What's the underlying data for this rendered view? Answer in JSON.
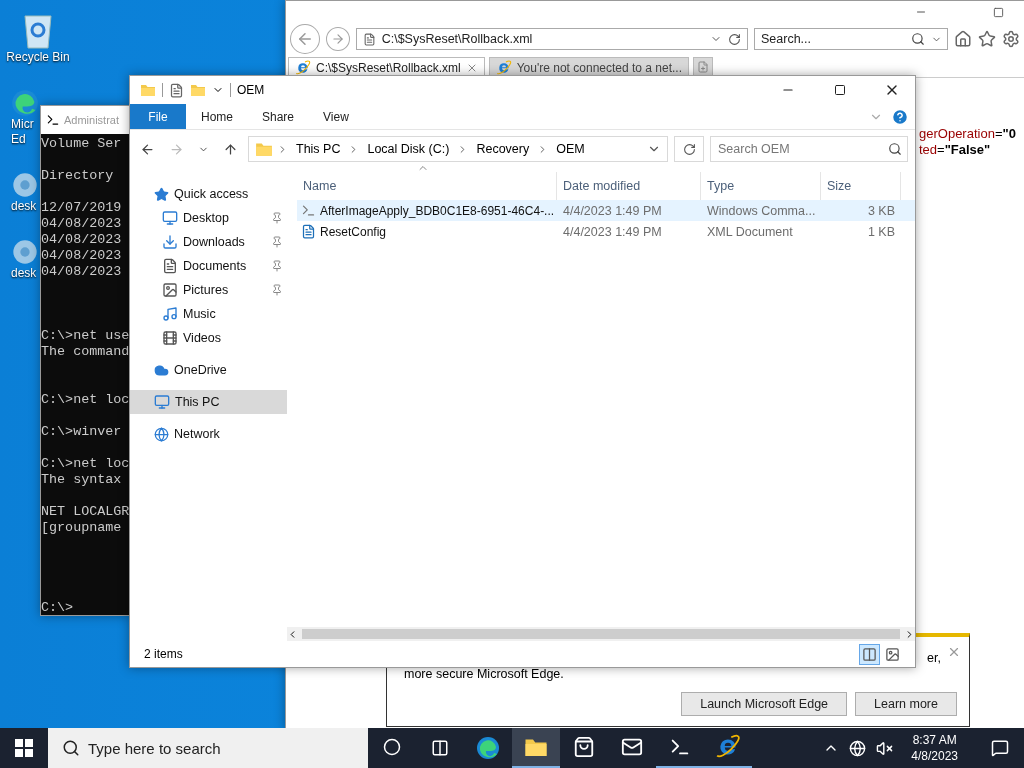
{
  "desktop": {
    "icons": [
      {
        "lines": [
          "Recycle Bin"
        ]
      },
      {
        "lines": [
          "Micr",
          "Ed"
        ]
      },
      {
        "lines": [
          "desk"
        ]
      },
      {
        "lines": [
          "desk"
        ]
      }
    ]
  },
  "browser": {
    "address": "C:\\$SysReset\\Rollback.xml",
    "search": {
      "placeholder": "Search..."
    },
    "tabs": [
      {
        "label": "C:\\$SysReset\\Rollback.xml",
        "selected": true
      },
      {
        "label": "You're not connected to a net...",
        "selected": false
      }
    ],
    "xml_lines": [
      {
        "attr": "gerOperation",
        "sep": "=",
        "value": "\"0"
      },
      {
        "attr": "ted",
        "sep": "=",
        "value": "\"False\""
      }
    ],
    "notification": {
      "lines": [
        "er,",
        "more secure Microsoft Edge."
      ],
      "buttons": [
        "Launch Microsoft Edge",
        "Learn more"
      ]
    }
  },
  "console": {
    "title": "Administrat",
    "blocks": [
      [
        "Volume Ser"
      ],
      [
        "Directory"
      ],
      [
        "12/07/2019",
        "04/08/2023",
        "04/08/2023",
        "04/08/2023",
        "04/08/2023"
      ],
      [
        "C:\\>net use",
        "The command"
      ],
      [
        "C:\\>net loc"
      ],
      [
        "C:\\>winver"
      ],
      [
        "C:\\>net loc",
        "The syntax"
      ],
      [
        "NET LOCALGR",
        "[groupname"
      ],
      [
        "C:\\>"
      ]
    ]
  },
  "explorer": {
    "title": "OEM",
    "file_tab": "File",
    "ribbon_tabs": [
      "Home",
      "Share",
      "View"
    ],
    "path": [
      "This PC",
      "Local Disk (C:)",
      "Recovery",
      "OEM"
    ],
    "search": {
      "placeholder": "Search OEM"
    },
    "nav": [
      {
        "label": "Quick access",
        "selected": false,
        "children": [
          {
            "label": "Desktop",
            "selected": false,
            "pinned": true
          },
          {
            "label": "Downloads",
            "selected": false,
            "pinned": true
          },
          {
            "label": "Documents",
            "selected": false,
            "pinned": true
          },
          {
            "label": "Pictures",
            "selected": false,
            "pinned": true
          },
          {
            "label": "Music",
            "selected": false,
            "pinned": false
          },
          {
            "label": "Videos",
            "selected": false,
            "pinned": false
          }
        ]
      },
      {
        "label": "OneDrive",
        "selected": false
      },
      {
        "label": "This PC",
        "selected": true
      },
      {
        "label": "Network",
        "selected": false
      }
    ],
    "columns": [
      "Name",
      "Date modified",
      "Type",
      "Size"
    ],
    "rows": [
      {
        "name": "AfterImageApply_BDB0C1E8-6951-46C4-...",
        "date": "4/4/2023 1:49 PM",
        "type": "Windows Comma...",
        "size": "3 KB",
        "hovered": true
      },
      {
        "name": "ResetConfig",
        "date": "4/4/2023 1:49 PM",
        "type": "XML Document",
        "size": "1 KB",
        "hovered": false
      }
    ],
    "status": "2 items",
    "views": [
      {
        "selected": true
      },
      {
        "selected": false
      }
    ]
  },
  "taskbar": {
    "search": {
      "placeholder": "Type here to search"
    },
    "apps": [
      {
        "active": false,
        "running": false
      },
      {
        "active": true,
        "running": true
      },
      {
        "active": false,
        "running": false
      },
      {
        "active": false,
        "running": false
      },
      {
        "active": false,
        "running": true
      },
      {
        "active": false,
        "running": true
      }
    ],
    "time": "8:37 AM",
    "date": "4/8/2023"
  }
}
